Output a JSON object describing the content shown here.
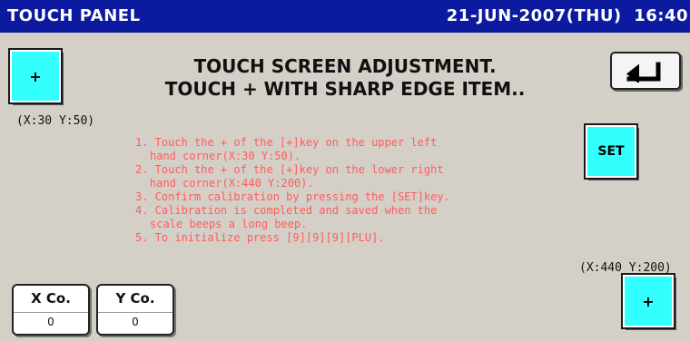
{
  "header": {
    "title": "TOUCH PANEL",
    "datetime": "21-JUN-2007(THU)  16:40"
  },
  "heading": {
    "line1": "TOUCH SCREEN ADJUSTMENT.",
    "line2": "TOUCH + WITH SHARP EDGE ITEM.."
  },
  "buttons": {
    "plus_upper_left": "+",
    "plus_lower_right": "+",
    "set": "SET",
    "back_icon": "back-arrow-icon"
  },
  "coordinates": {
    "upper_left": "(X:30 Y:50)",
    "lower_right": "(X:440 Y:200)"
  },
  "instructions": [
    "1. Touch the + of the [+]key on the upper left",
    "hand corner(X:30 Y:50).",
    "2. Touch the + of the [+]key on the lower right",
    "hand corner(X:440 Y:200).",
    "3. Confirm calibration by pressing the [SET]key.",
    "4. Calibration is completed and saved when the",
    "scale beeps a long beep.",
    "5. To initialize press [9][9][9][PLU]."
  ],
  "readouts": {
    "x_label": "X Co.",
    "x_value": "0",
    "y_label": "Y Co.",
    "y_value": "0"
  },
  "colors": {
    "titlebar": "#0b1a9e",
    "background": "#d4d0c8",
    "key_cyan": "#33ffff",
    "instruction_text": "#ff5c5c"
  }
}
